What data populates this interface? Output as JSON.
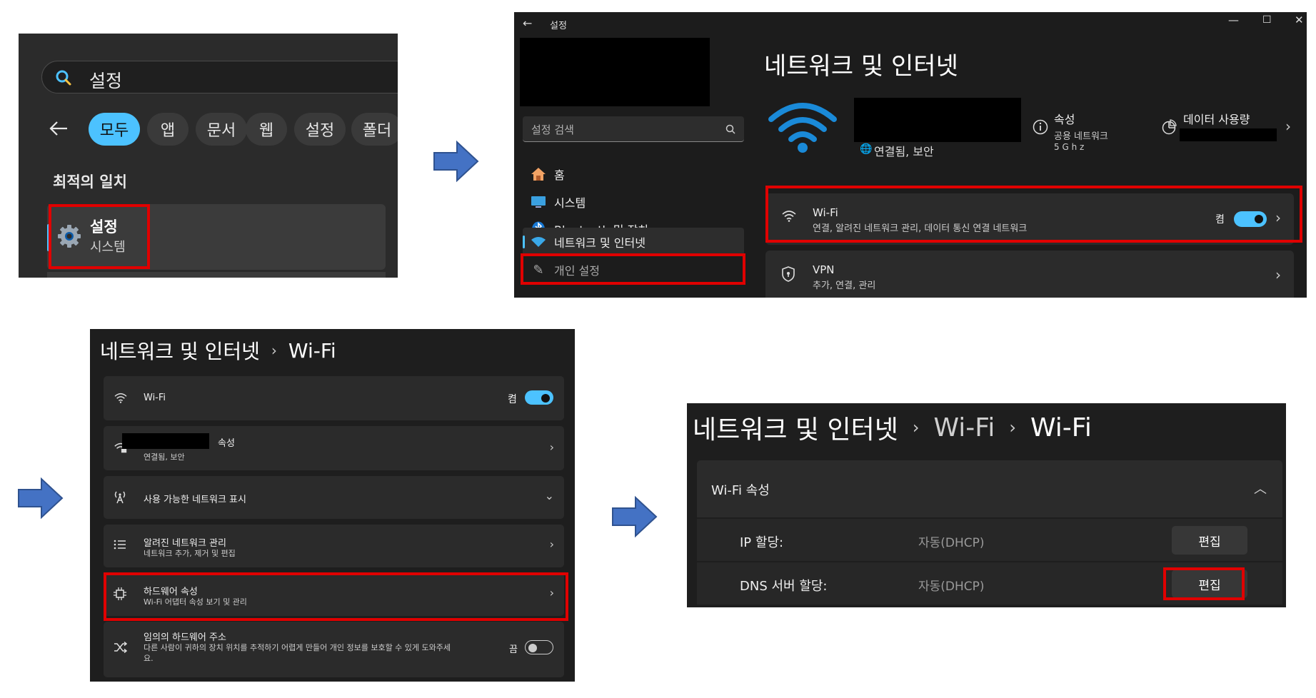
{
  "search_panel": {
    "query": "설정",
    "filters": [
      "모두",
      "앱",
      "문서",
      "웹",
      "설정",
      "폴더"
    ],
    "best_match_heading": "최적의 일치",
    "result": {
      "title": "설정",
      "subtitle": "시스템"
    }
  },
  "settings_panel": {
    "window_title": "설정",
    "search_placeholder": "설정 검색",
    "nav": [
      {
        "label": "홈",
        "icon": "home-icon"
      },
      {
        "label": "시스템",
        "icon": "monitor-icon"
      },
      {
        "label": "Bluetooth 및 장치",
        "icon": "bluetooth-icon"
      },
      {
        "label": "네트워크 및 인터넷",
        "icon": "wifi-icon"
      },
      {
        "label": "개인 설정",
        "icon": "brush-icon"
      }
    ],
    "page_title": "네트워크 및 인터넷",
    "connection_status": "연결됨, 보안",
    "properties": {
      "title": "속성",
      "line1": "공용 네트워크",
      "line2": "5 G h z"
    },
    "data_usage": {
      "title": "데이터 사용량"
    },
    "wifi_card": {
      "title": "Wi-Fi",
      "subtitle": "연결, 알려진 네트워크 관리, 데이터 통신 연결 네트워크",
      "toggle_label": "켬"
    },
    "vpn_card": {
      "title": "VPN",
      "subtitle": "추가, 연결, 관리"
    }
  },
  "wifi_panel": {
    "breadcrumb": [
      "네트워크 및 인터넷",
      "Wi-Fi"
    ],
    "rows": [
      {
        "title": "Wi-Fi",
        "subtitle": "",
        "toggle_label": "켬"
      },
      {
        "title": "속성",
        "subtitle": "연결됨, 보안"
      },
      {
        "title": "사용 가능한 네트워크 표시",
        "subtitle": ""
      },
      {
        "title": "알려진 네트워크 관리",
        "subtitle": "네트워크 추가, 제거 및 편집"
      },
      {
        "title": "하드웨어 속성",
        "subtitle": "Wi-Fi 어댑터 속성 보기 및 관리"
      },
      {
        "title": "임의의 하드웨어 주소",
        "subtitle": "다른 사람이 귀하의 장치 위치를 추적하기 어렵게 만들어 개인 정보를 보호할 수 있게 도와주세",
        "subtitle2": "요.",
        "toggle_label": "끔"
      }
    ]
  },
  "properties_panel": {
    "breadcrumb": [
      "네트워크 및 인터넷",
      "Wi-Fi",
      "Wi-Fi"
    ],
    "section_title": "Wi-Fi 속성",
    "rows": [
      {
        "key": "IP 할당:",
        "value": "자동(DHCP)",
        "button": "편집"
      },
      {
        "key": "DNS 서버 할당:",
        "value": "자동(DHCP)",
        "button": "편집"
      }
    ]
  },
  "colors": {
    "accent": "#4cc2ff",
    "highlight": "#e00000",
    "arrow": "#4472c4"
  }
}
